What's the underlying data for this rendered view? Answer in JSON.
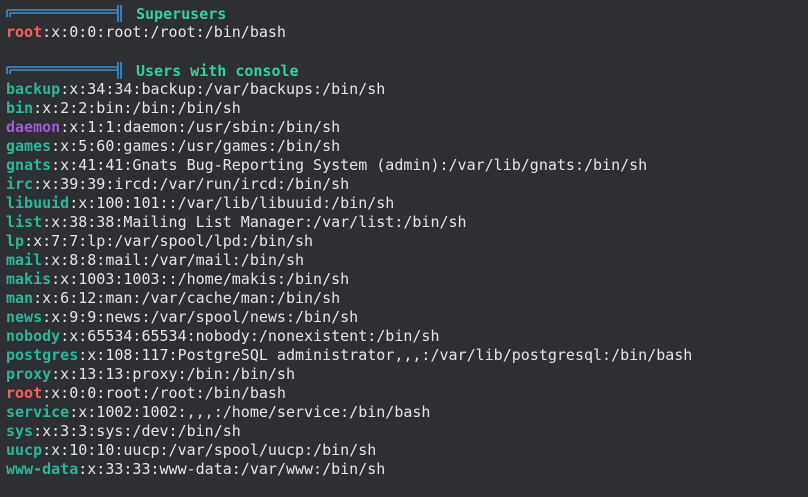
{
  "colors": {
    "background": "#2d2f33",
    "text": "#e6e6e6",
    "title": "#2fd49a",
    "user_teal": "#2db79a",
    "user_red": "#ff5f5f",
    "user_purple": "#a25bd4",
    "box_art": "#3b8fd6"
  },
  "superusers": {
    "title": "Superusers",
    "entries": [
      {
        "user": "root",
        "rest": ":x:0:0:root:/root:/bin/bash",
        "color": "red"
      }
    ]
  },
  "console_users": {
    "title": "Users with console",
    "entries": [
      {
        "user": "backup",
        "rest": ":x:34:34:backup:/var/backups:/bin/sh",
        "color": "teal"
      },
      {
        "user": "bin",
        "rest": ":x:2:2:bin:/bin:/bin/sh",
        "color": "teal"
      },
      {
        "user": "daemon",
        "rest": ":x:1:1:daemon:/usr/sbin:/bin/sh",
        "color": "purple"
      },
      {
        "user": "games",
        "rest": ":x:5:60:games:/usr/games:/bin/sh",
        "color": "teal"
      },
      {
        "user": "gnats",
        "rest": ":x:41:41:Gnats Bug-Reporting System (admin):/var/lib/gnats:/bin/sh",
        "color": "teal"
      },
      {
        "user": "irc",
        "rest": ":x:39:39:ircd:/var/run/ircd:/bin/sh",
        "color": "teal"
      },
      {
        "user": "libuuid",
        "rest": ":x:100:101::/var/lib/libuuid:/bin/sh",
        "color": "teal"
      },
      {
        "user": "list",
        "rest": ":x:38:38:Mailing List Manager:/var/list:/bin/sh",
        "color": "teal"
      },
      {
        "user": "lp",
        "rest": ":x:7:7:lp:/var/spool/lpd:/bin/sh",
        "color": "teal"
      },
      {
        "user": "mail",
        "rest": ":x:8:8:mail:/var/mail:/bin/sh",
        "color": "teal"
      },
      {
        "user": "makis",
        "rest": ":x:1003:1003::/home/makis:/bin/sh",
        "color": "teal"
      },
      {
        "user": "man",
        "rest": ":x:6:12:man:/var/cache/man:/bin/sh",
        "color": "teal"
      },
      {
        "user": "news",
        "rest": ":x:9:9:news:/var/spool/news:/bin/sh",
        "color": "teal"
      },
      {
        "user": "nobody",
        "rest": ":x:65534:65534:nobody:/nonexistent:/bin/sh",
        "color": "teal"
      },
      {
        "user": "postgres",
        "rest": ":x:108:117:PostgreSQL administrator,,,:/var/lib/postgresql:/bin/bash",
        "color": "teal"
      },
      {
        "user": "proxy",
        "rest": ":x:13:13:proxy:/bin:/bin/sh",
        "color": "teal"
      },
      {
        "user": "root",
        "rest": ":x:0:0:root:/root:/bin/bash",
        "color": "red"
      },
      {
        "user": "service",
        "rest": ":x:1002:1002:,,,:/home/service:/bin/bash",
        "color": "teal"
      },
      {
        "user": "sys",
        "rest": ":x:3:3:sys:/dev:/bin/sh",
        "color": "teal"
      },
      {
        "user": "uucp",
        "rest": ":x:10:10:uucp:/var/spool/uucp:/bin/sh",
        "color": "teal"
      },
      {
        "user": "www-data",
        "rest": ":x:33:33:www-data:/var/www:/bin/sh",
        "color": "teal"
      }
    ]
  }
}
